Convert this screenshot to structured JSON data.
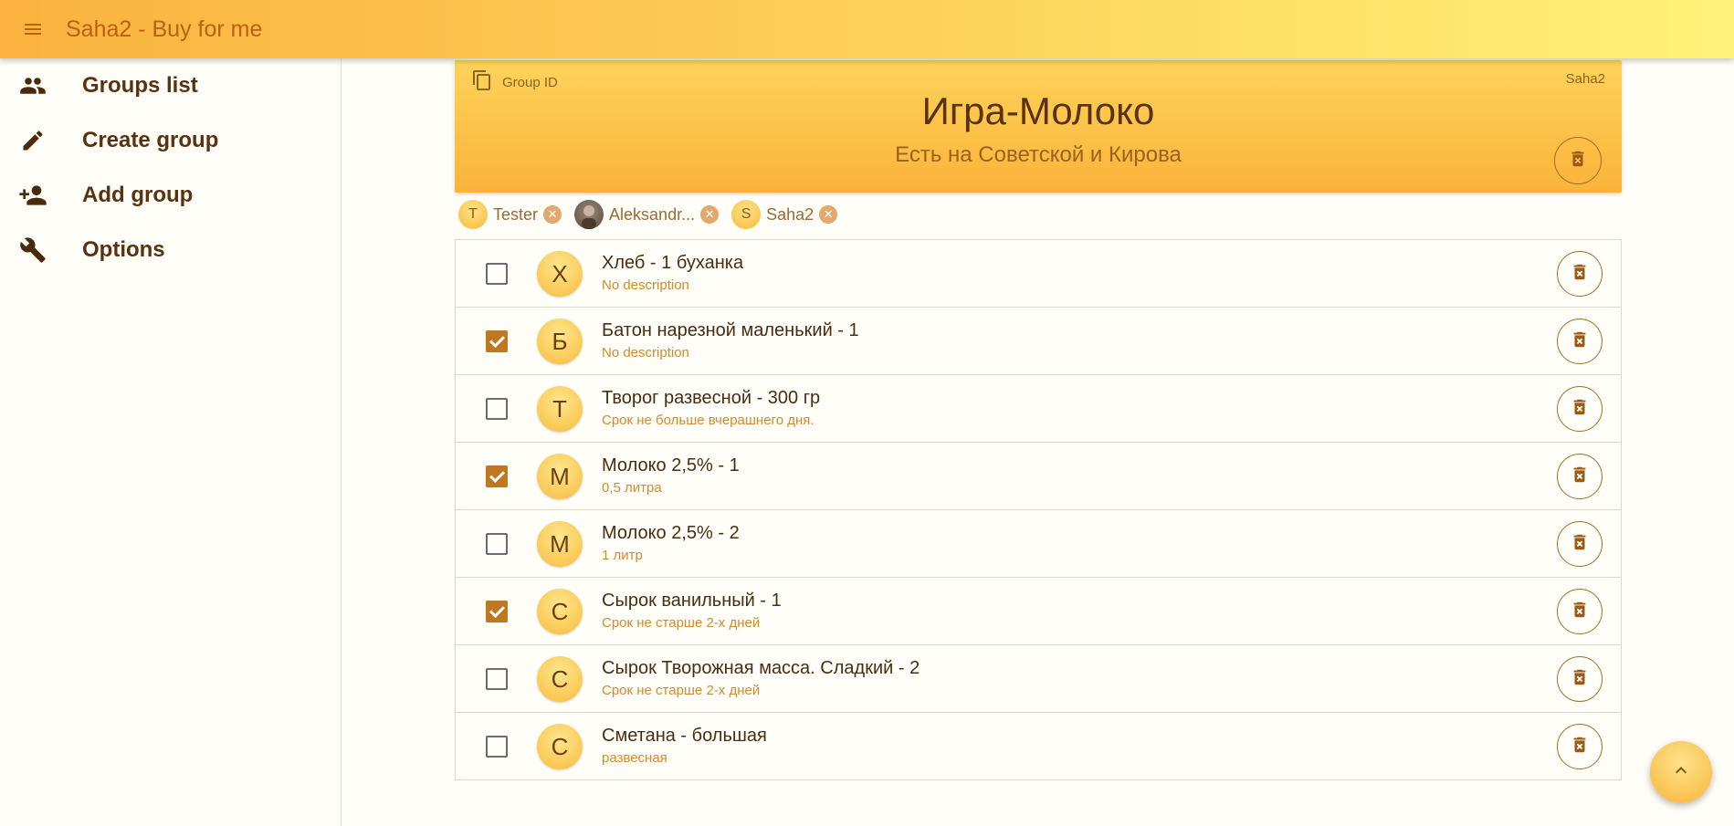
{
  "app": {
    "title": "Saha2 - Buy for me"
  },
  "drawer": {
    "items": [
      {
        "label": "Groups list",
        "icon": "people-icon"
      },
      {
        "label": "Create group",
        "icon": "pencil-icon"
      },
      {
        "label": "Add group",
        "icon": "person-add-icon"
      },
      {
        "label": "Options",
        "icon": "wrench-icon"
      }
    ]
  },
  "group": {
    "id_label": "Group ID",
    "owner": "Saha2",
    "title": "Игра-Молоко",
    "description": "Есть на Советской и Кирова"
  },
  "members": [
    {
      "initial": "T",
      "name": "Tester"
    },
    {
      "initial": "",
      "name": "Aleksandr...",
      "photo": true
    },
    {
      "initial": "S",
      "name": "Saha2"
    }
  ],
  "items": [
    {
      "initial": "Х",
      "name": "Хлеб - 1 буханка",
      "description": "No description",
      "checked": false
    },
    {
      "initial": "Б",
      "name": "Батон нарезной маленький - 1",
      "description": "No description",
      "checked": true
    },
    {
      "initial": "Т",
      "name": "Творог развесной - 300 гр",
      "description": "Срок не больше вчерашнего дня.",
      "checked": false
    },
    {
      "initial": "М",
      "name": "Молоко 2,5% - 1",
      "description": "0,5 литра",
      "checked": true
    },
    {
      "initial": "М",
      "name": "Молоко 2,5% - 2",
      "description": "1 литр",
      "checked": false
    },
    {
      "initial": "С",
      "name": "Сырок ванильный - 1",
      "description": "Срок не старше 2-х дней",
      "checked": true
    },
    {
      "initial": "С",
      "name": "Сырок Творожная масса. Сладкий - 2",
      "description": "Срок не старше 2-х дней",
      "checked": false
    },
    {
      "initial": "С",
      "name": "Сметана - большая",
      "description": "развесная",
      "checked": false
    }
  ],
  "colors": {
    "accent": "#c0771f",
    "appbar_start": "#fbb23f",
    "appbar_end": "#fff27a",
    "text_dark": "#5a3210",
    "description": "#d48a2a"
  }
}
